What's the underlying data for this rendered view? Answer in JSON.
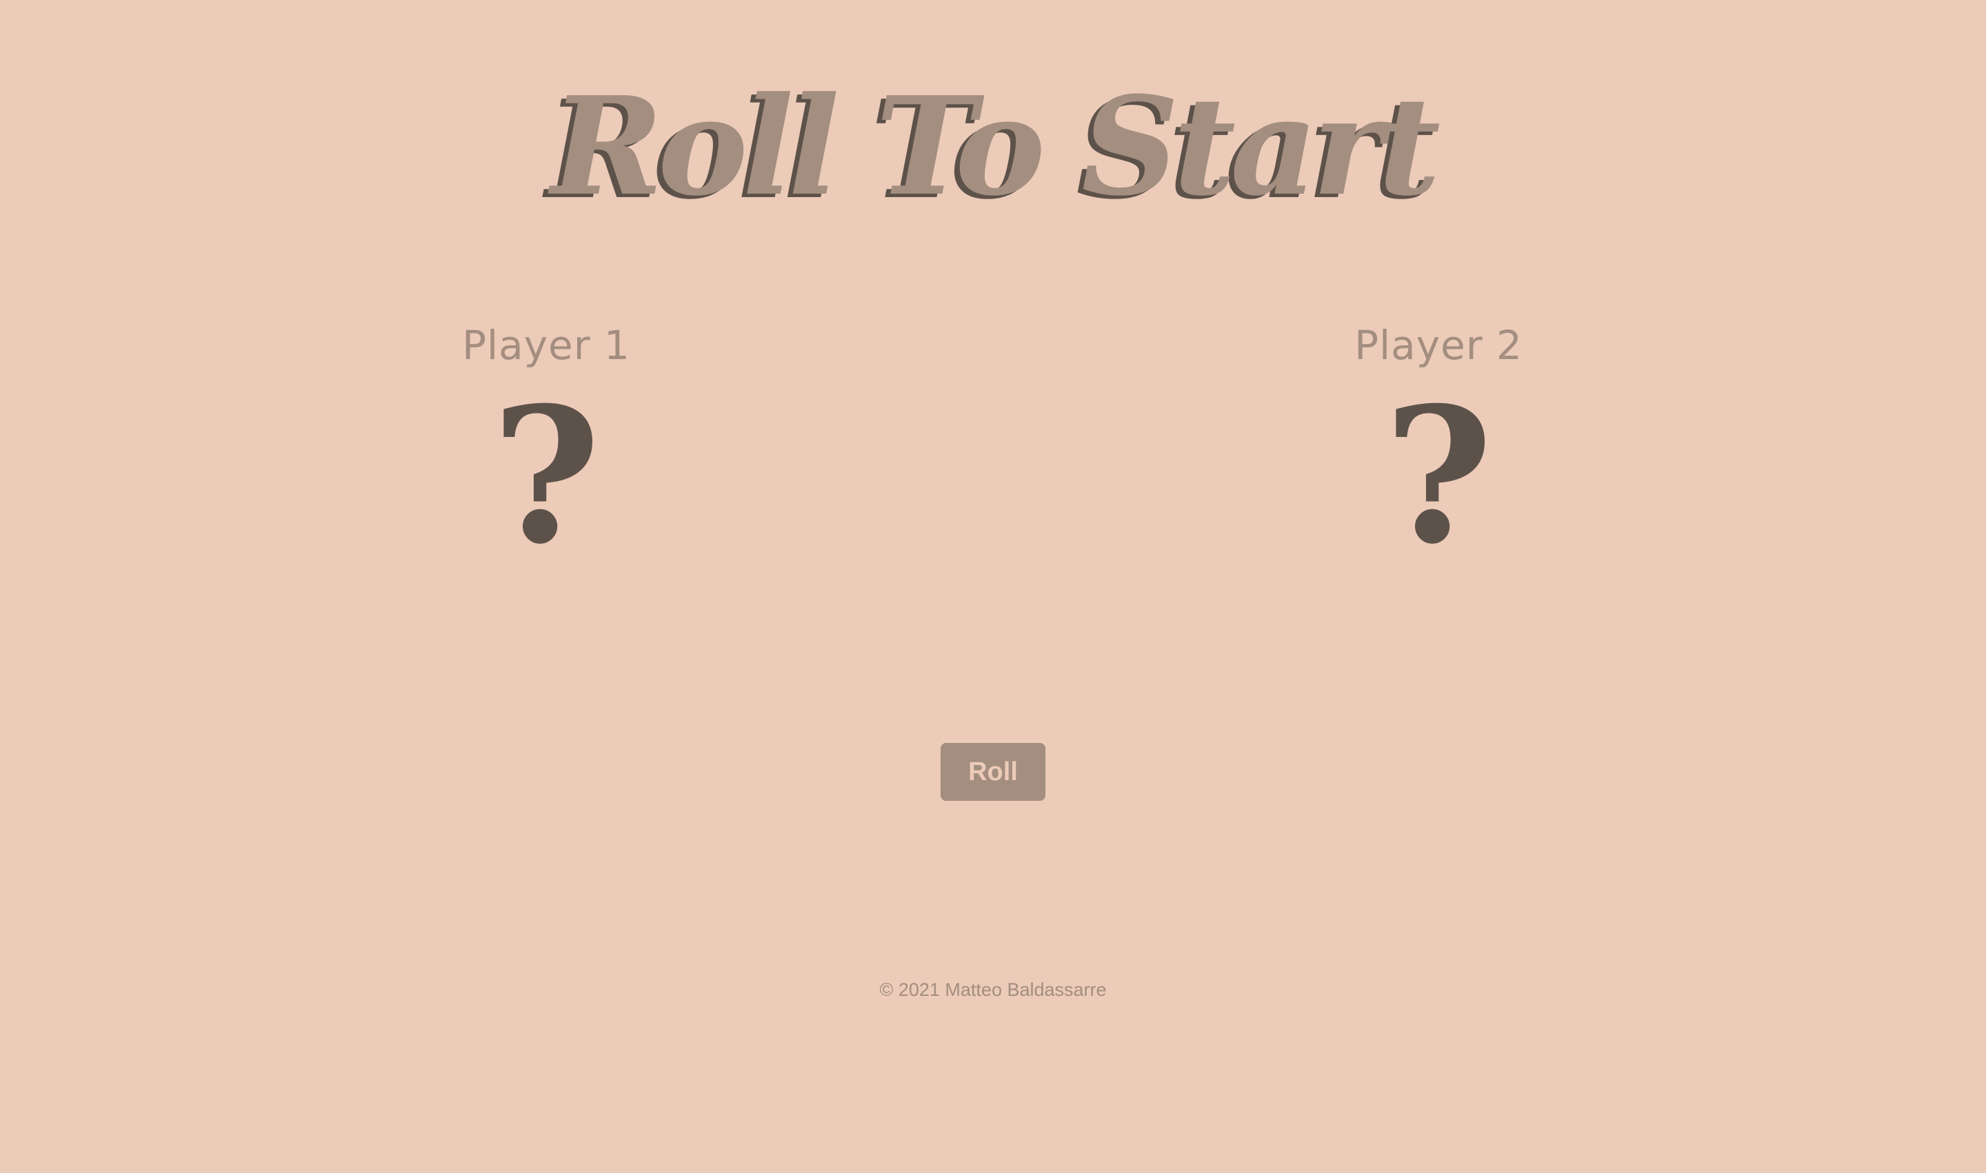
{
  "header": {
    "title": "Roll To Start"
  },
  "players": [
    {
      "label": "Player 1",
      "dice": "?"
    },
    {
      "label": "Player 2",
      "dice": "?"
    }
  ],
  "controls": {
    "roll_label": "Roll"
  },
  "footer": {
    "text": "© 2021 Matteo Baldassarre"
  },
  "colors": {
    "background": "#ECCBB8",
    "accent": "#A38E80",
    "dark": "#5D524A"
  }
}
